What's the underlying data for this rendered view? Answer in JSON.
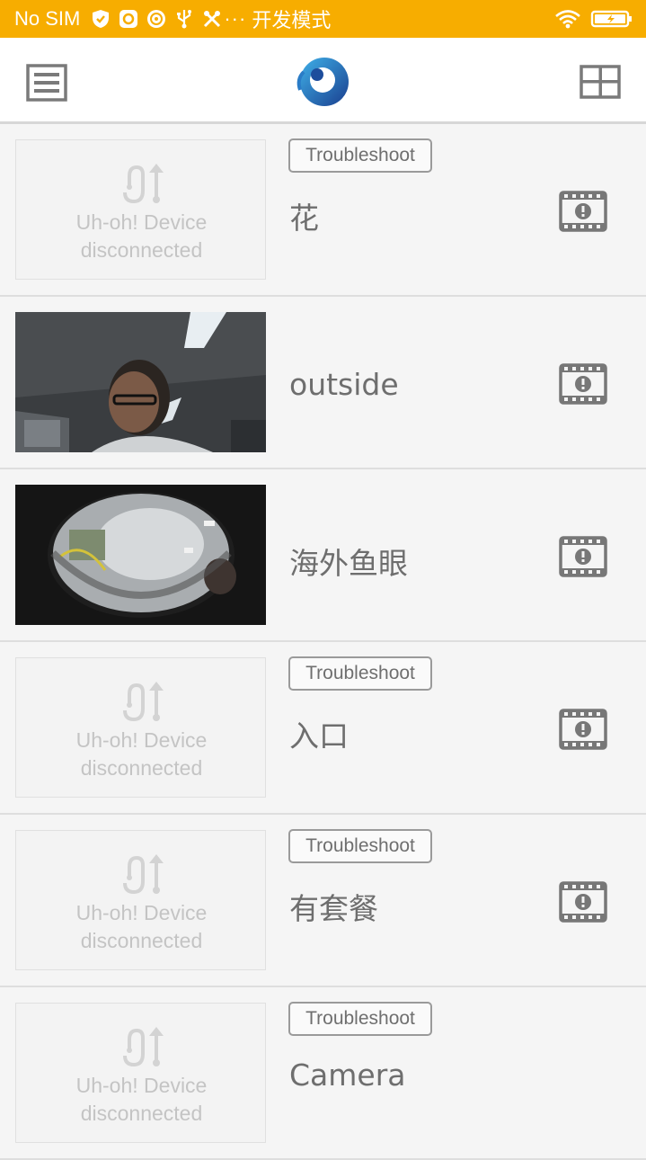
{
  "status_bar": {
    "carrier": "No SIM",
    "dots": "···",
    "mode": "开发模式",
    "background": "#f7ad00"
  },
  "app_bar": {
    "menu_icon": "hamburger-menu-icon",
    "logo": "app-logo",
    "grid_icon": "grid-view-icon"
  },
  "cameras": [
    {
      "name": "花",
      "status": "disconnected",
      "troubleshoot": "Troubleshoot",
      "message_line1": "Uh-oh! Device",
      "message_line2": "disconnected"
    },
    {
      "name": "outside",
      "status": "online",
      "preview": "indoor-office-photo"
    },
    {
      "name": "海外鱼眼",
      "status": "online",
      "preview": "fisheye-office-photo"
    },
    {
      "name": "入口",
      "status": "disconnected",
      "troubleshoot": "Troubleshoot",
      "message_line1": "Uh-oh! Device",
      "message_line2": "disconnected"
    },
    {
      "name": "有套餐",
      "status": "disconnected",
      "troubleshoot": "Troubleshoot",
      "message_line1": "Uh-oh! Device",
      "message_line2": "disconnected"
    },
    {
      "name": "Camera",
      "status": "disconnected",
      "troubleshoot": "Troubleshoot",
      "message_line1": "Uh-oh! Device",
      "message_line2": "disconnected"
    }
  ]
}
